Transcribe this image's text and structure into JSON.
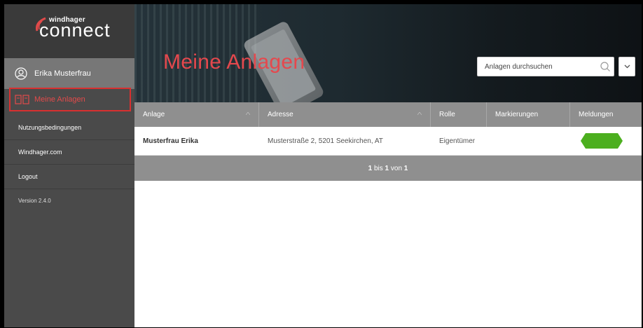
{
  "brand": {
    "small": "windhager",
    "big": "connect",
    "accent": "#e5484d"
  },
  "user": {
    "name": "Erika Musterfrau",
    "icon": "user-icon"
  },
  "nav": {
    "active": {
      "label": "Meine Anlagen",
      "icon": "installations-icon"
    },
    "items": [
      {
        "label": "Nutzungsbedingungen"
      },
      {
        "label": "Windhager.com"
      },
      {
        "label": "Logout"
      }
    ],
    "version": "Version 2.4.0"
  },
  "header": {
    "title": "Meine Anlagen",
    "search_placeholder": "Anlagen durchsuchen"
  },
  "table": {
    "columns": [
      "Anlage",
      "Adresse",
      "Rolle",
      "Markierungen",
      "Meldungen"
    ],
    "rows": [
      {
        "anlage": "Musterfrau Erika",
        "adresse": "Musterstraße 2, 5201 Seekirchen, AT",
        "rolle": "Eigentümer",
        "markierungen": "",
        "meldungen_status": "ok",
        "meldungen_color": "#4caf1f"
      }
    ],
    "pager": {
      "from": "1",
      "bis": "bis",
      "to": "1",
      "von": "von",
      "total": "1"
    }
  }
}
